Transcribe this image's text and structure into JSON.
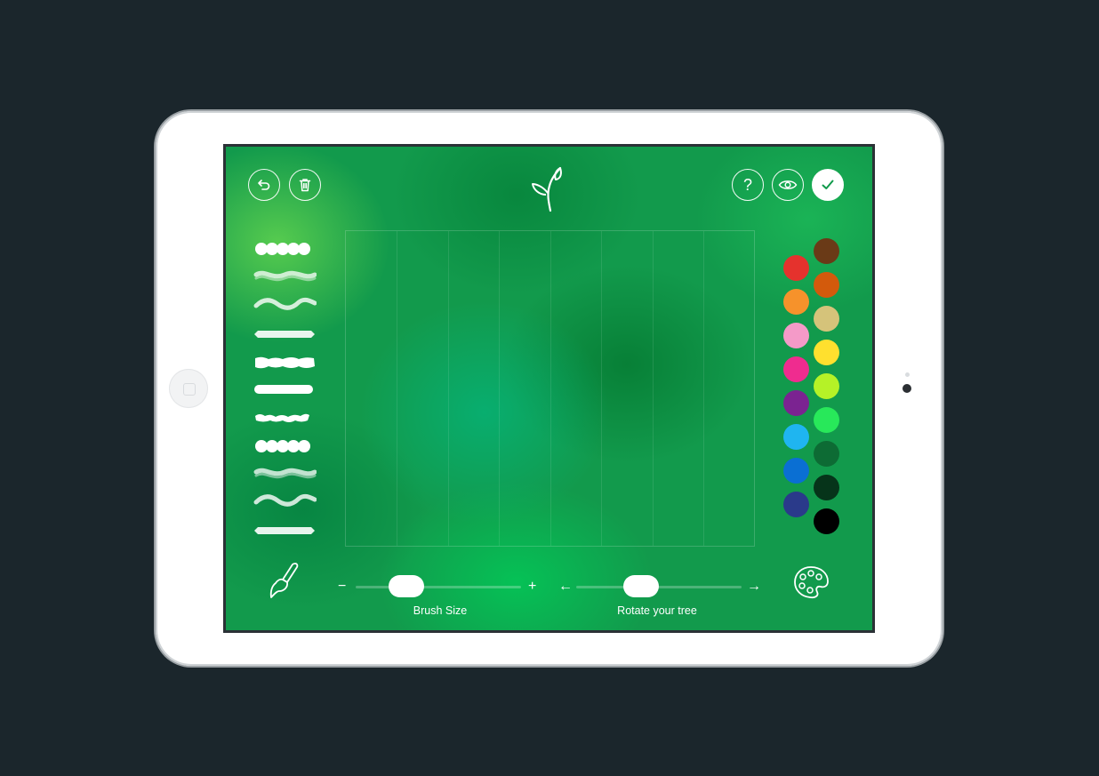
{
  "toolbar": {
    "undo_icon": "undo-arrow-icon",
    "delete_icon": "trash-icon",
    "logo_icon": "sprout-icon",
    "help_label": "?",
    "preview_icon": "eye-icon",
    "confirm_icon": "check-icon"
  },
  "brushes": [
    {
      "name": "round-dots"
    },
    {
      "name": "feather-wave"
    },
    {
      "name": "soft-wave"
    },
    {
      "name": "flat-blur"
    },
    {
      "name": "rough-stroke"
    },
    {
      "name": "solid-line"
    },
    {
      "name": "splatter"
    },
    {
      "name": "round-dots-2"
    },
    {
      "name": "feather-wave-2"
    },
    {
      "name": "soft-wave-2"
    },
    {
      "name": "flat-blur-2"
    }
  ],
  "palette": {
    "left_column": [
      "#e5322d",
      "#f6922b",
      "#f49ac8",
      "#ef2c8f",
      "#7b2391",
      "#1fb5f0",
      "#0a6fd3",
      "#2a3a8a"
    ],
    "right_column": [
      "#6a3a17",
      "#d35a0c",
      "#d5c37a",
      "#ffe02e",
      "#b5f227",
      "#28e85a",
      "#0d6b34",
      "#06341a",
      "#000000"
    ]
  },
  "brush_size": {
    "label": "Brush Size",
    "minus": "−",
    "plus": "+",
    "value": 0.25
  },
  "rotate": {
    "label": "Rotate your tree",
    "left": "←",
    "right": "→",
    "value": 0.36
  },
  "bottom": {
    "brush_tool_icon": "paintbrush-icon",
    "palette_icon": "palette-icon"
  }
}
